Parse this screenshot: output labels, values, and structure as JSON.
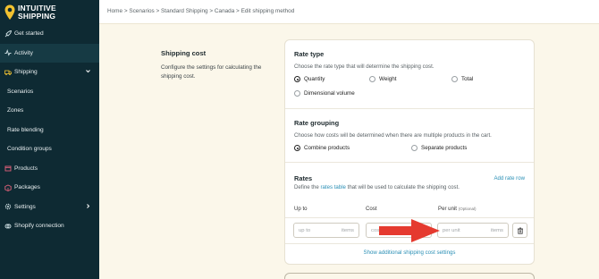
{
  "brand": {
    "line1": "INTUITIVE",
    "line2": "SHIPPING",
    "pin_color": "#f2c230"
  },
  "sidebar": {
    "items": [
      {
        "label": "Get started",
        "icon": "rocket-icon"
      },
      {
        "label": "Activity",
        "icon": "activity-icon",
        "active": true
      },
      {
        "label": "Shipping",
        "icon": "truck-icon",
        "expanded": true
      },
      {
        "label": "Scenarios"
      },
      {
        "label": "Zones"
      },
      {
        "label": "Rate blending"
      },
      {
        "label": "Condition groups"
      },
      {
        "label": "Products",
        "icon": "box-icon"
      },
      {
        "label": "Packages",
        "icon": "package-icon"
      },
      {
        "label": "Settings",
        "icon": "gear-icon"
      },
      {
        "label": "Shopify connection",
        "icon": "link-icon"
      }
    ]
  },
  "breadcrumb": "Home > Scenarios > Standard Shipping > Canada > Edit shipping method",
  "section": {
    "title": "Shipping cost",
    "description": "Configure the settings for calculating the shipping cost."
  },
  "rate_type": {
    "title": "Rate type",
    "subtitle": "Choose the rate type that will determine the shipping cost.",
    "options": [
      "Quantity",
      "Weight",
      "Total",
      "Dimensional volume"
    ],
    "selected": "Quantity"
  },
  "rate_grouping": {
    "title": "Rate grouping",
    "subtitle": "Choose how costs will be determined when there are multiple products in the cart.",
    "options": [
      "Combine products",
      "Separate products"
    ],
    "selected": "Combine products"
  },
  "rates": {
    "title": "Rates",
    "add_label": "Add rate row",
    "subtitle_pre": "Define the ",
    "subtitle_link": "rates table",
    "subtitle_post": " that will be used to calculate the shipping cost.",
    "columns": {
      "up_to": "Up to",
      "cost": "Cost",
      "per_unit": "Per unit",
      "optional": "(Optional)"
    },
    "row": {
      "up_to_placeholder": "up to",
      "up_to_suffix": "items",
      "cost_placeholder": "cost",
      "per_unit_placeholder": "per unit",
      "per_unit_suffix": "items"
    },
    "show_more": "Show additional shipping cost settings"
  },
  "accent": "#e53a2f"
}
